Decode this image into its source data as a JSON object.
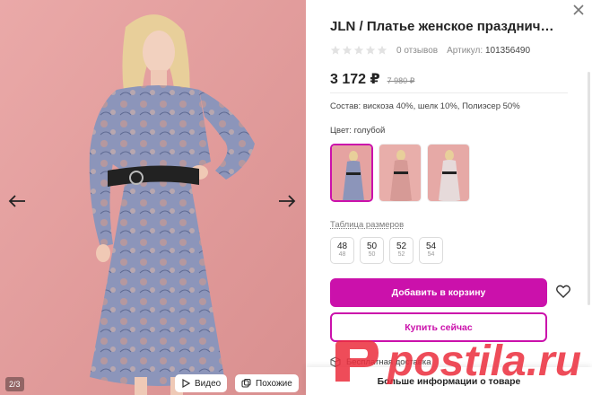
{
  "gallery": {
    "counter": "2/3",
    "video_label": "Видео",
    "similar_label": "Похожие"
  },
  "product": {
    "title": "JLN / Платье женское празднич…",
    "reviews": "0 отзывов",
    "article_label": "Артикул:",
    "article_value": "101356490",
    "price": "3 172 ₽",
    "old_price": "7 980 ₽",
    "composition": "Состав: вискоза 40%, шелк 10%, Полиэсер 50%",
    "color_label": "Цвет:",
    "color_value": "голубой",
    "size_table_label": "Таблица размеров",
    "sizes": [
      {
        "size": "48",
        "ru": "48"
      },
      {
        "size": "50",
        "ru": "50"
      },
      {
        "size": "52",
        "ru": "52"
      },
      {
        "size": "54",
        "ru": "54"
      }
    ],
    "add_to_cart_label": "Добавить в корзину",
    "buy_now_label": "Купить сейчас",
    "delivery_label": "Бесплатная доставка",
    "more_info_label": "Больше информации о товаре"
  },
  "colors": {
    "accent": "#cb11ab",
    "background_photo": "#e39f9e",
    "dress": "#8a93b8"
  },
  "watermark": "postila.ru"
}
